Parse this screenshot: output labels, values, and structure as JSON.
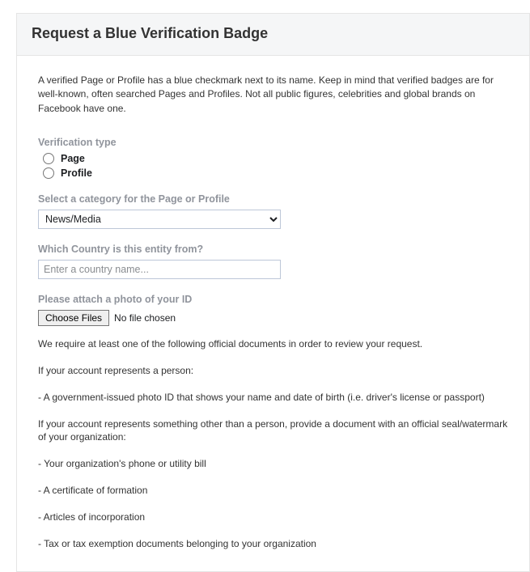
{
  "header": {
    "title": "Request a Blue Verification Badge"
  },
  "intro": "A verified Page or Profile has a blue checkmark next to its name. Keep in mind that verified badges are for well-known, often searched Pages and Profiles. Not all public figures, celebrities and global brands on Facebook have one.",
  "verification_type": {
    "label": "Verification type",
    "options": {
      "page": "Page",
      "profile": "Profile"
    }
  },
  "category": {
    "label": "Select a category for the Page or Profile",
    "selected": "News/Media"
  },
  "country": {
    "label": "Which Country is this entity from?",
    "placeholder": "Enter a country name...",
    "value": ""
  },
  "id_upload": {
    "label": "Please attach a photo of your ID",
    "button": "Choose Files",
    "status": "No file chosen"
  },
  "docs": {
    "intro": "We require at least one of the following official documents in order to review your request.",
    "person_heading": "If your account represents a person:",
    "person_item": "- A government-issued photo ID that shows your name and date of birth (i.e. driver's license or passport)",
    "org_heading": "If your account represents something other than a person, provide a document with an official seal/watermark of your organization:",
    "org_item1": "- Your organization's phone or utility bill",
    "org_item2": "- A certificate of formation",
    "org_item3": "- Articles of incorporation",
    "org_item4": "- Tax or tax exemption documents belonging to your organization"
  }
}
